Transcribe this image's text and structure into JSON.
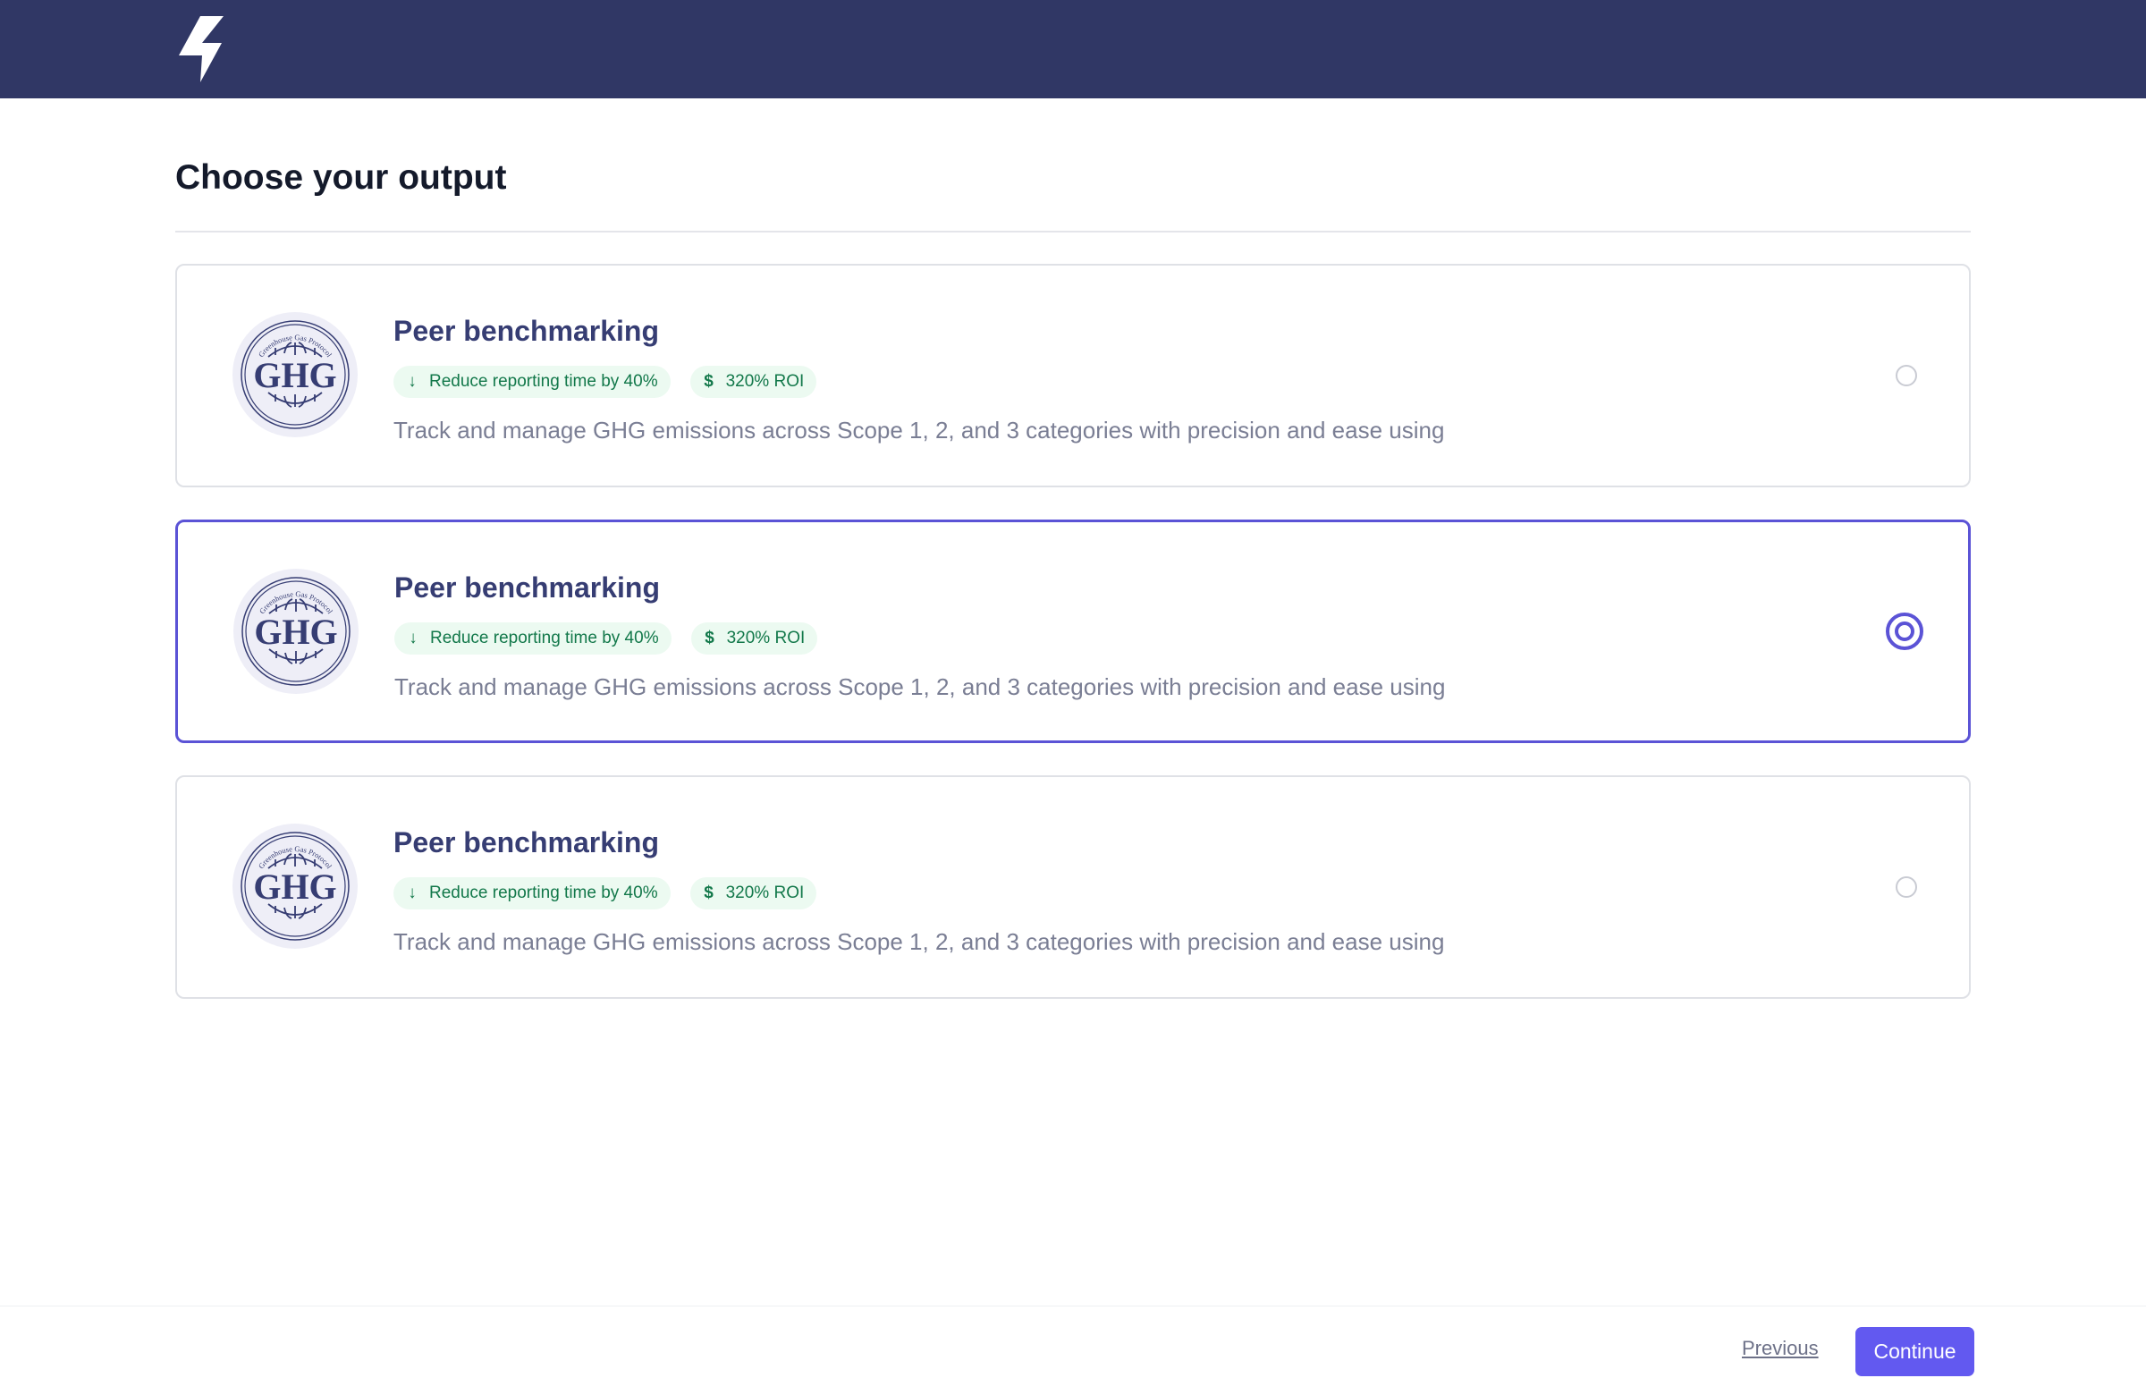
{
  "header": {
    "logo_icon": "lightning-bolt-icon",
    "background_color": "#303765"
  },
  "page": {
    "title": "Choose your output"
  },
  "options": [
    {
      "logo_text": "GHG",
      "logo_arc_text": "Greenhouse Gas Protocol",
      "title": "Peer benchmarking",
      "tags": [
        {
          "icon": "arrow-down-icon",
          "label": "Reduce reporting time by 40%"
        },
        {
          "icon": "dollar-icon",
          "label": "320% ROI"
        }
      ],
      "description": "Track and manage GHG emissions across Scope 1, 2, and 3 categories with precision and ease using",
      "selected": false
    },
    {
      "logo_text": "GHG",
      "logo_arc_text": "Greenhouse Gas Protocol",
      "title": "Peer benchmarking",
      "tags": [
        {
          "icon": "arrow-down-icon",
          "label": "Reduce reporting time by 40%"
        },
        {
          "icon": "dollar-icon",
          "label": "320% ROI"
        }
      ],
      "description": "Track and manage GHG emissions across Scope 1, 2, and 3 categories with precision and ease using",
      "selected": true
    },
    {
      "logo_text": "GHG",
      "logo_arc_text": "Greenhouse Gas Protocol",
      "title": "Peer benchmarking",
      "tags": [
        {
          "icon": "arrow-down-icon",
          "label": "Reduce reporting time by 40%"
        },
        {
          "icon": "dollar-icon",
          "label": "320% ROI"
        }
      ],
      "description": "Track and manage GHG emissions across Scope 1, 2, and 3 categories with precision and ease using",
      "selected": false
    }
  ],
  "footer": {
    "previous_label": "Previous",
    "continue_label": "Continue"
  },
  "colors": {
    "accent": "#5b53d6",
    "button": "#6259f0",
    "tag_bg": "#ecfaf1",
    "tag_text": "#12784a",
    "card_title": "#363d73"
  }
}
